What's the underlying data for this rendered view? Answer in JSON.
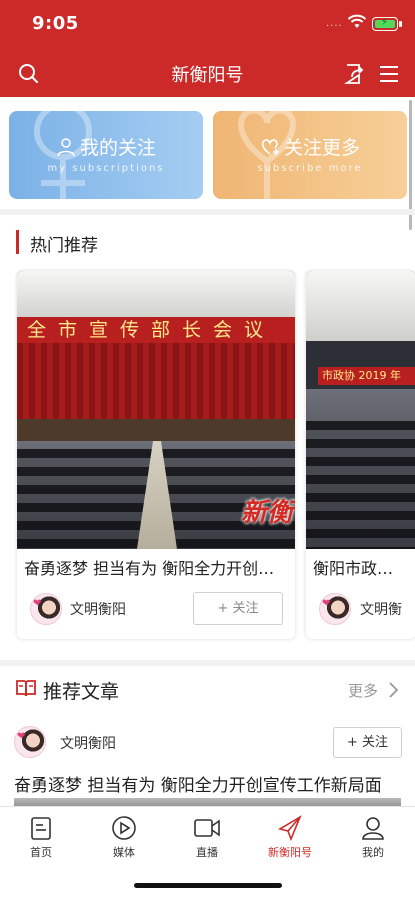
{
  "status_bar": {
    "time": "9:05",
    "signal": "····"
  },
  "header": {
    "title": "新衡阳号"
  },
  "subscribe": {
    "my": {
      "title": "我的关注",
      "subtitle": "my subscriptions"
    },
    "more": {
      "title": "关注更多",
      "subtitle": "subscribe more"
    }
  },
  "hot": {
    "title": "热门推荐",
    "cards": [
      {
        "banner": "全市宣传部长会议",
        "logo": "新衡",
        "headline": "奋勇逐梦 担当有为 衡阳全力开创…",
        "author": "文明衡阳",
        "follow": "+ 关注"
      },
      {
        "banner": "市政协 2019 年",
        "headline": "衡阳市政协…",
        "author": "文明衡"
      }
    ]
  },
  "recommend": {
    "title": "推荐文章",
    "more": "更多",
    "article": {
      "author": "文明衡阳",
      "follow": "+ 关注",
      "headline": "奋勇逐梦 担当有为 衡阳全力开创宣传工作新局面"
    }
  },
  "tabs": [
    {
      "label": "首页",
      "icon": "home-icon"
    },
    {
      "label": "媒体",
      "icon": "play-icon"
    },
    {
      "label": "直播",
      "icon": "video-camera-icon"
    },
    {
      "label": "新衡阳号",
      "icon": "paper-plane-icon",
      "active": true
    },
    {
      "label": "我的",
      "icon": "user-icon"
    }
  ],
  "colors": {
    "brand": "#cc2a28",
    "blue_card": "#7bb1e7",
    "orange_card": "#efb573"
  }
}
